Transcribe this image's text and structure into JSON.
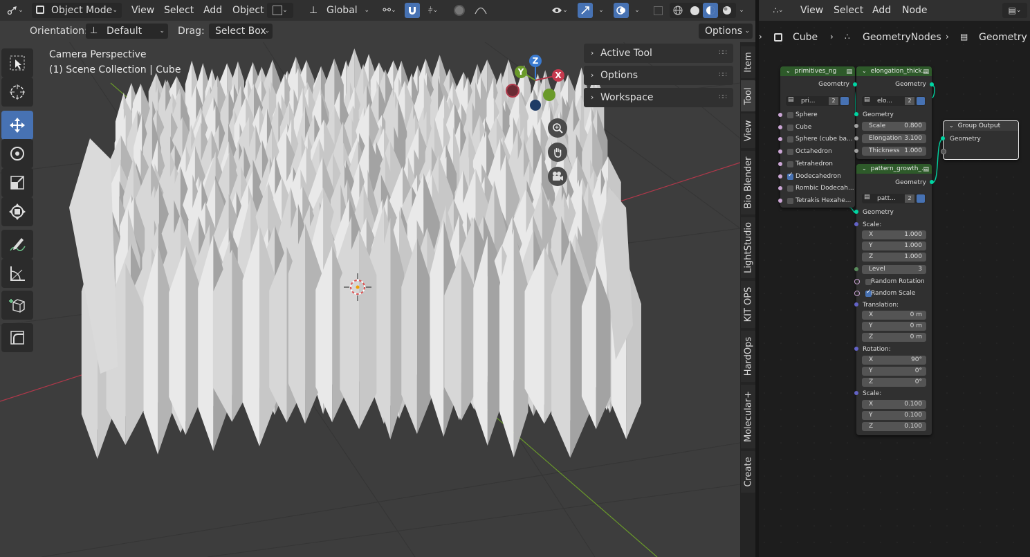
{
  "viewport": {
    "header": {
      "editor_icon": "editor-type-icon",
      "mode": "Object Mode",
      "menus": [
        "View",
        "Select",
        "Add",
        "Object"
      ],
      "transform_orientation": "Global"
    },
    "tool_header": {
      "orientation_label": "Orientation:",
      "orientation_value": "Default",
      "drag_label": "Drag:",
      "drag_value": "Select Box",
      "options_label": "Options"
    },
    "overlay_text": {
      "line1": "Camera Perspective",
      "line2": "(1) Scene Collection | Cube"
    },
    "gizmo": {
      "x": "X",
      "y": "Y",
      "z": "Z"
    },
    "npanel": {
      "sections": [
        "Active Tool",
        "Options",
        "Workspace"
      ],
      "tabs": [
        "Item",
        "Tool",
        "View",
        "Bio Blender",
        "LightStudio",
        "KIT OPS",
        "HardOps",
        "Molecular+",
        "Create"
      ]
    },
    "colors": {
      "x_axis": "#b0384a",
      "y_axis": "#6a9a2a",
      "z_axis": "#3a7ad0",
      "accent": "#4772b3"
    }
  },
  "node_editor": {
    "header_menus": [
      "View",
      "Select",
      "Add",
      "Node"
    ],
    "breadcrumb": [
      "Cube",
      "GeometryNodes",
      "Geometry N"
    ],
    "nodes": {
      "primitives": {
        "title": "primitives_ng",
        "output": "Geometry",
        "group_name": "pri...",
        "users": "2",
        "options": [
          {
            "label": "Sphere",
            "checked": false
          },
          {
            "label": "Cube",
            "checked": false
          },
          {
            "label": "Sphere (cube ba...",
            "checked": false
          },
          {
            "label": "Octahedron",
            "checked": false
          },
          {
            "label": "Tetrahedron",
            "checked": false
          },
          {
            "label": "Dodecahedron",
            "checked": true
          },
          {
            "label": "Rombic Dodecah...",
            "checked": false
          },
          {
            "label": "Tetrakis Hexahe...",
            "checked": false
          }
        ]
      },
      "elongation": {
        "title": "elongation_thick...",
        "output": "Geometry",
        "group_name": "elo...",
        "users": "2",
        "input": "Geometry",
        "fields": [
          {
            "label": "Scale",
            "value": "0.800"
          },
          {
            "label": "Elongation",
            "value": "3.100"
          },
          {
            "label": "Thickness",
            "value": "1.000"
          }
        ]
      },
      "pattern": {
        "title": "pattern_growth_...",
        "output": "Geometry",
        "group_name": "patt...",
        "users": "2",
        "input": "Geometry",
        "scale_label": "Scale:",
        "scale": [
          {
            "label": "X",
            "value": "1.000"
          },
          {
            "label": "Y",
            "value": "1.000"
          },
          {
            "label": "Z",
            "value": "1.000"
          }
        ],
        "level": {
          "label": "Level",
          "value": "3"
        },
        "random_rotation": {
          "label": "Random Rotation",
          "checked": false
        },
        "random_scale": {
          "label": "Random Scale",
          "checked": true
        },
        "translation_label": "Translation:",
        "translation": [
          {
            "label": "X",
            "value": "0 m"
          },
          {
            "label": "Y",
            "value": "0 m"
          },
          {
            "label": "Z",
            "value": "0 m"
          }
        ],
        "rotation_label": "Rotation:",
        "rotation": [
          {
            "label": "X",
            "value": "90°"
          },
          {
            "label": "Y",
            "value": "0°"
          },
          {
            "label": "Z",
            "value": "0°"
          }
        ],
        "scale2_label": "Scale:",
        "scale2": [
          {
            "label": "X",
            "value": "0.100"
          },
          {
            "label": "Y",
            "value": "0.100"
          },
          {
            "label": "Z",
            "value": "0.100"
          }
        ]
      },
      "group_output": {
        "title": "Group Output",
        "input": "Geometry"
      }
    }
  }
}
